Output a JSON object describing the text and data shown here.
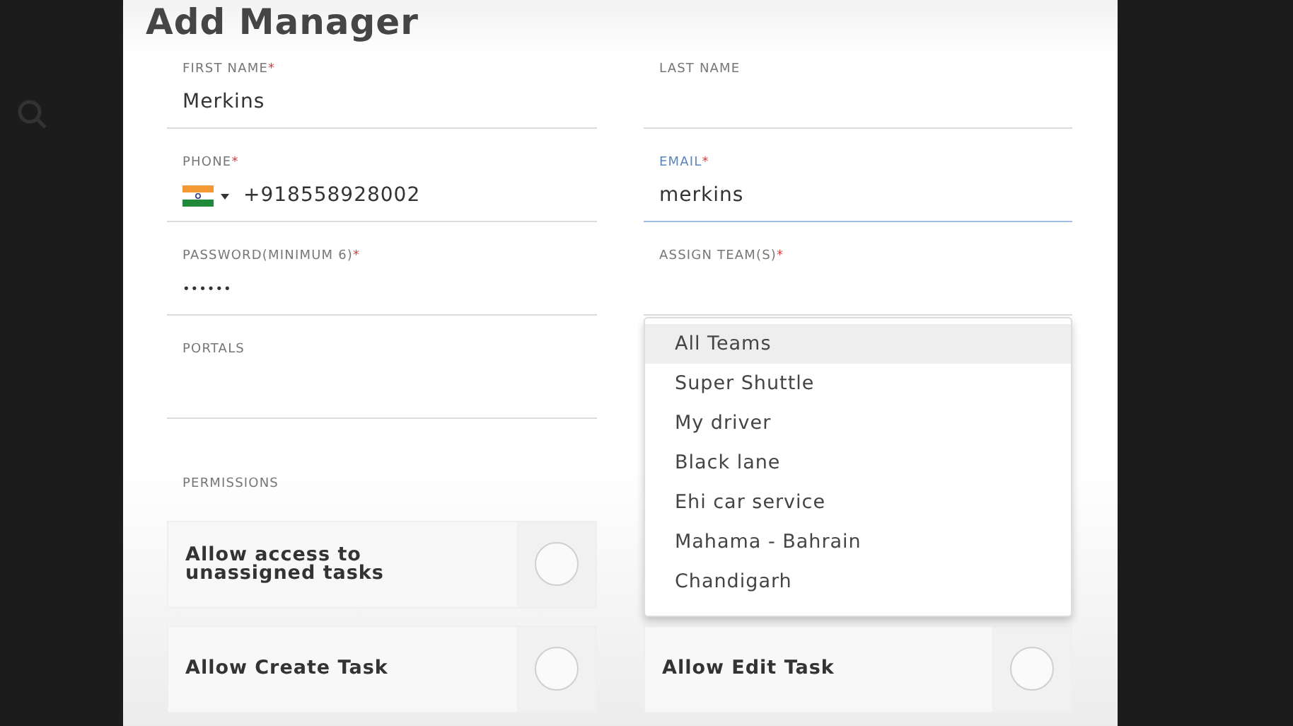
{
  "dialog": {
    "title": "Add Manager"
  },
  "left_fields": [
    {
      "kind": "text",
      "label": "FIRST NAME",
      "required_mark": "*",
      "value": "Merkins",
      "focused": false
    },
    {
      "kind": "phone",
      "label": "PHONE",
      "required_mark": "*",
      "value": "+918558928002",
      "focused": false
    },
    {
      "kind": "password",
      "label": "PASSWORD(MINIMUM 6)",
      "required_mark": "*",
      "value": "••••••",
      "focused": false
    },
    {
      "kind": "text",
      "label": "PORTALS",
      "focused": false
    }
  ],
  "right_fields": [
    {
      "kind": "text",
      "label": "LAST NAME",
      "focused": false
    },
    {
      "kind": "text",
      "label": "EMAIL",
      "required_mark": "*",
      "value": "merkins",
      "focused": true
    },
    {
      "kind": "select",
      "label": "ASSIGN TEAM(S)",
      "required_mark": "*",
      "focused": false
    }
  ],
  "team_options": [
    {
      "label": "All Teams",
      "selected": true
    },
    {
      "label": "Super Shuttle",
      "selected": false
    },
    {
      "label": "My driver",
      "selected": false
    },
    {
      "label": "Black lane",
      "selected": false
    },
    {
      "label": "Ehi car service",
      "selected": false
    },
    {
      "label": "Mahama - Bahrain",
      "selected": false
    },
    {
      "label": "Chandigarh",
      "selected": false
    }
  ],
  "permissions": {
    "label": "PERMISSIONS",
    "rows": [
      {
        "left": {
          "label": "Allow access to unassigned tasks",
          "checked": false
        }
      },
      {
        "left": {
          "label": "Allow Create Task",
          "checked": false
        },
        "right": {
          "label": "Allow Edit Task",
          "checked": false
        }
      }
    ]
  }
}
